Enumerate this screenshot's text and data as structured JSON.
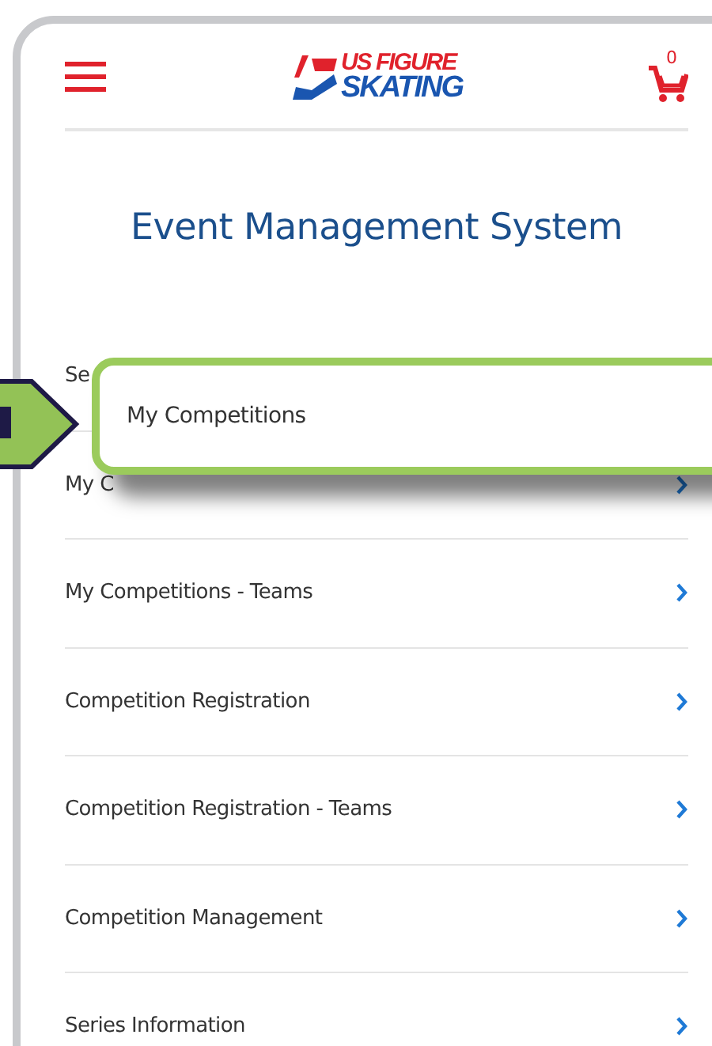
{
  "header": {
    "logo": {
      "line_1": "US FIGURE",
      "line_2": "SKATING"
    },
    "cart_count": "0"
  },
  "title": "Event Management System",
  "menu": [
    {
      "label": "Se",
      "chevron": false
    },
    {
      "label": "My C",
      "chevron": true
    },
    {
      "label": "My Competitions - Teams",
      "chevron": true
    },
    {
      "label": "Competition Registration",
      "chevron": true
    },
    {
      "label": "Competition Registration - Teams",
      "chevron": true
    },
    {
      "label": "Competition Management",
      "chevron": true
    },
    {
      "label": "Series Information",
      "chevron": true
    }
  ],
  "callout": {
    "label": "My Competitions"
  }
}
